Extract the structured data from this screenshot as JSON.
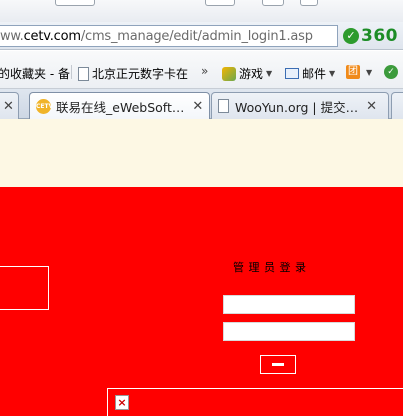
{
  "address_bar": {
    "url_prefix": "ww.",
    "url_host": "cetv.com",
    "url_path": "/cms_manage/edit/admin_login1.asp",
    "brand": "360"
  },
  "favorites": [
    {
      "label": "的收藏夹 - 备",
      "icon": "none"
    },
    {
      "label": "北京正元数字卡在",
      "icon": "page-icon"
    },
    {
      "label": "»",
      "icon": "none"
    },
    {
      "label": "游戏",
      "icon": "game-icon"
    },
    {
      "label": "邮件",
      "icon": "mail-icon"
    },
    {
      "label": "团",
      "icon": "group-buy-icon"
    },
    {
      "label": "",
      "icon": "lock-icon"
    }
  ],
  "tabs": [
    {
      "label": "联易在线_eWebSoft…",
      "active": true,
      "icon": "cetv-favicon"
    },
    {
      "label": "WooYun.org | 提交…",
      "active": false,
      "icon": "page-icon"
    }
  ],
  "login": {
    "title": "管理员登录",
    "username_value": "",
    "password_value": ""
  },
  "colors": {
    "page_background": "#ff0000",
    "banner_background": "#fdf8e4"
  }
}
